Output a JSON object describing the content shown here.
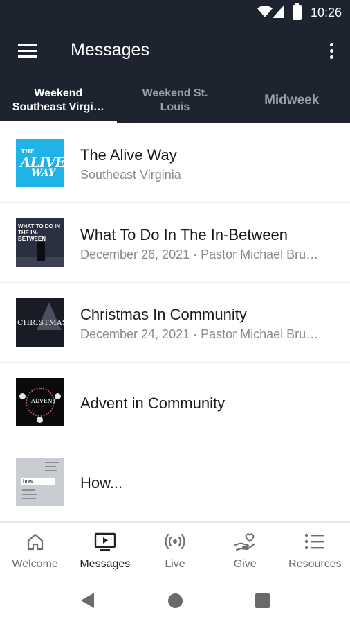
{
  "status_bar": {
    "time": "10:26"
  },
  "app_bar": {
    "title": "Messages",
    "menu_icon": "hamburger-menu-icon",
    "more_icon": "more-vertical-icon"
  },
  "tabs": [
    {
      "line1": "Weekend",
      "line2": "Southeast Virgi…",
      "active": true
    },
    {
      "line1": "Weekend St.",
      "line2": "Louis",
      "active": false
    },
    {
      "line1": "Midweek",
      "line2": "",
      "active": false
    }
  ],
  "messages": [
    {
      "title": "The Alive Way",
      "subtitle": "Southeast Virginia",
      "thumb": {
        "line1": "THE",
        "line2": "ALIVE",
        "line3": "WAY",
        "bg": "#1fb3e8"
      }
    },
    {
      "title": "What To Do In The In-Between",
      "subtitle": "December 26, 2021 · Pastor Michael Bru…",
      "thumb": {
        "line1": "WHAT TO DO IN",
        "line2": "THE IN-BETWEEN",
        "bg": "#2a3040"
      }
    },
    {
      "title": "Christmas In Community",
      "subtitle": "December 24, 2021 · Pastor Michael Bru…",
      "thumb": {
        "line1": "CHRISTMAS",
        "bg": "#191c24"
      }
    },
    {
      "title": "Advent in Community",
      "subtitle": "",
      "thumb": {
        "line1": "ADVENT",
        "bg": "#0a0a0a"
      }
    },
    {
      "title": "How...",
      "subtitle": "",
      "thumb": {
        "search_text": "how...",
        "bg": "#c9ccd1"
      }
    }
  ],
  "bottom_nav": [
    {
      "label": "Welcome",
      "icon": "home-icon",
      "active": false
    },
    {
      "label": "Messages",
      "icon": "tv-play-icon",
      "active": true
    },
    {
      "label": "Live",
      "icon": "broadcast-icon",
      "active": false
    },
    {
      "label": "Give",
      "icon": "heart-hand-icon",
      "active": false
    },
    {
      "label": "Resources",
      "icon": "list-icon",
      "active": false
    }
  ],
  "colors": {
    "header_bg": "#1e2330",
    "tab_inactive": "#9aa0ab",
    "subtitle": "#8a8a8a"
  }
}
